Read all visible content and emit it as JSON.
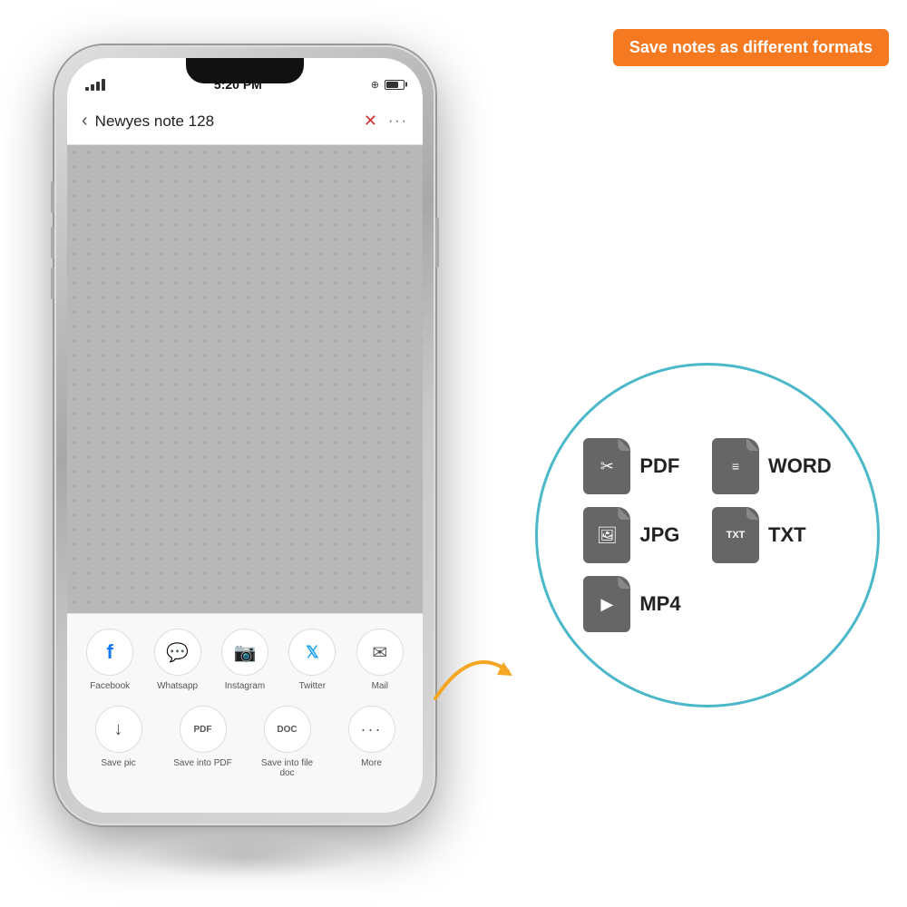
{
  "banner": {
    "text": "Save notes as different formats"
  },
  "phone": {
    "statusBar": {
      "time": "5:20 PM",
      "locationIcon": "⊕"
    },
    "navBar": {
      "backLabel": "‹",
      "title": "Newyes note 128",
      "moreLabel": "···"
    },
    "sharePanel": {
      "row1": [
        {
          "id": "facebook",
          "label": "Facebook",
          "icon": "f"
        },
        {
          "id": "whatsapp",
          "label": "Whatsapp",
          "icon": "W"
        },
        {
          "id": "instagram",
          "label": "Instagram",
          "icon": "◎"
        },
        {
          "id": "twitter",
          "label": "Twitter",
          "icon": "𝕏"
        },
        {
          "id": "mail",
          "label": "Mail",
          "icon": "✉"
        }
      ],
      "row2": [
        {
          "id": "savepic",
          "label": "Save pic",
          "icon": "↓"
        },
        {
          "id": "savetopdf",
          "label": "Save into PDF",
          "icon": "PDF"
        },
        {
          "id": "savetofiledoc",
          "label": "Save into file doc",
          "icon": "DOC"
        },
        {
          "id": "more",
          "label": "More",
          "icon": "···"
        }
      ]
    }
  },
  "formatsCircle": {
    "formats": [
      {
        "id": "pdf",
        "name": "PDF",
        "iconSymbol": "pdf"
      },
      {
        "id": "word",
        "name": "WORD",
        "iconSymbol": "word"
      },
      {
        "id": "jpg",
        "name": "JPG",
        "iconSymbol": "jpg"
      },
      {
        "id": "txt",
        "name": "TXT",
        "iconSymbol": "txt"
      },
      {
        "id": "mp4",
        "name": "MP4",
        "iconSymbol": "mp4"
      }
    ]
  }
}
